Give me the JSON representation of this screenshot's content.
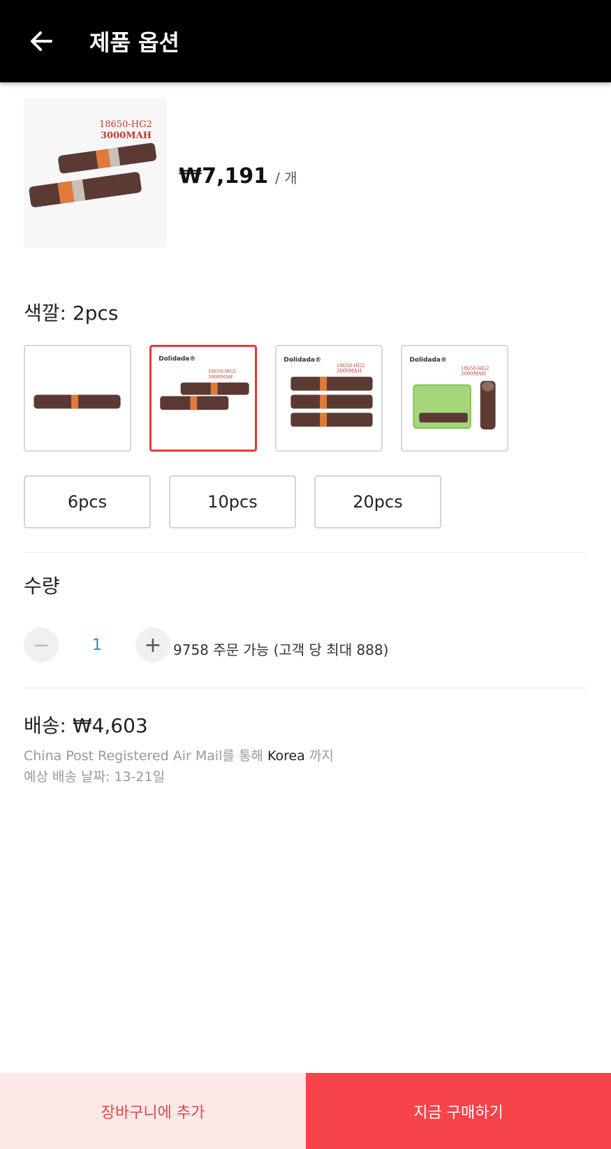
{
  "header": {
    "title": "제품 옵션",
    "back_icon": "arrow-left-icon"
  },
  "product": {
    "image_label_line1": "18650-HG2",
    "image_label_line2": "3000MAH",
    "price": "₩7,191",
    "price_unit": "/ 개"
  },
  "color": {
    "label": "색깔: 2pcs",
    "brand": "Dolidada®",
    "swatch_label_line1": "18650-HG2",
    "swatch_label_line2": "3000MAH"
  },
  "quantity_options": [
    "6pcs",
    "10pcs",
    "20pcs"
  ],
  "quantity": {
    "label": "수량",
    "value": "1",
    "minus": "−",
    "plus": "+",
    "stock": "9758 주문 가능 (고객 당 최대 888)"
  },
  "shipping": {
    "label": "배송: ₩4,603",
    "method_prefix": "China Post Registered Air Mail를 통해 ",
    "destination": "Korea",
    "method_suffix": " 까지",
    "eta": "예상 배송 날짜: 13-21일"
  },
  "actions": {
    "add_to_cart": "장바구니에 추가",
    "buy_now": "지금 구매하기"
  },
  "colors": {
    "accent": "#f6444a",
    "accent_light": "#fde8e8",
    "qty_blue": "#2a8ab8"
  }
}
